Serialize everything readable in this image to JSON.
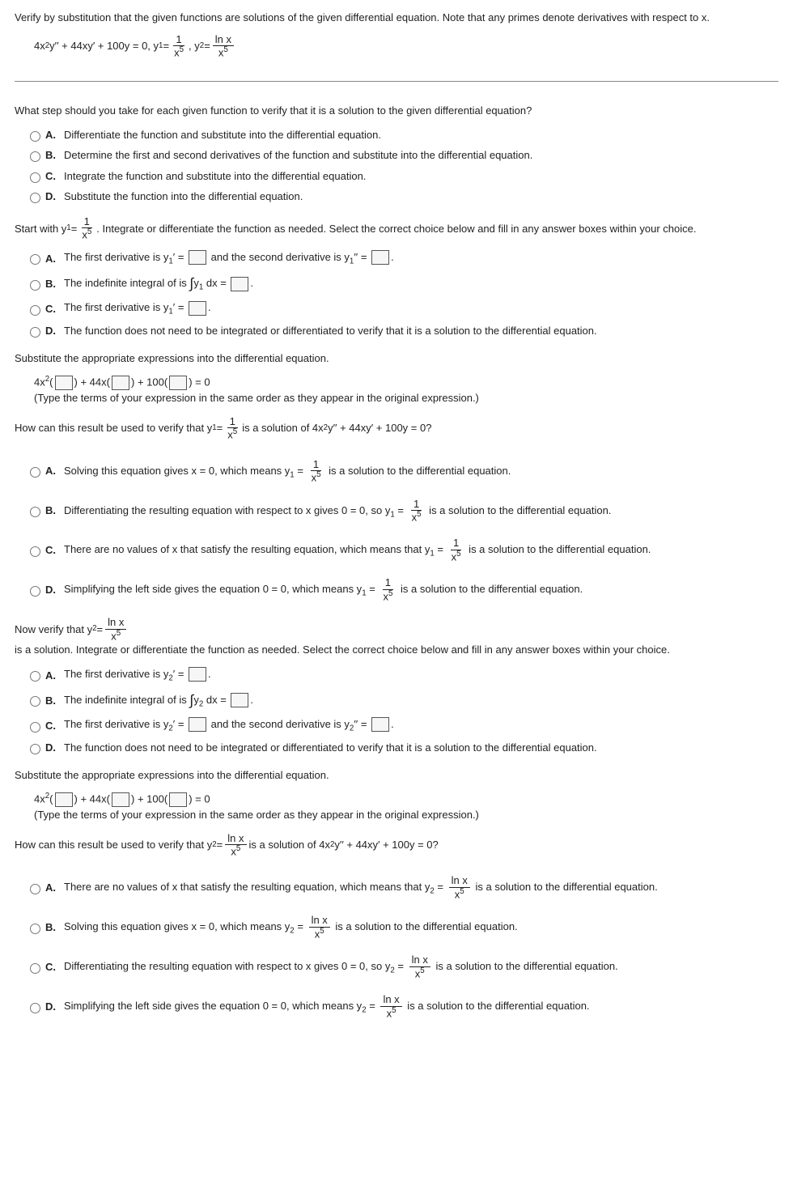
{
  "intro": "Verify by substitution that the given functions are solutions of the given differential equation. Note that any primes denote derivatives with respect to x.",
  "eq_lhs": "4x",
  "eq_y2d": "y′′ + 44xy′ + 100y = 0, y",
  "eq_eqal": " = ",
  "frac1_num": "1",
  "frac1_den_x": "x",
  "comma_y2": ", y",
  "frac2_num": "ln x",
  "frac2_den_x": "x",
  "q1": "What step should you take for each given function to verify that it is a solution to the given differential equation?",
  "q1a": "Differentiate the function and substitute into the differential equation.",
  "q1b": "Determine the first and second derivatives of the function and substitute into the differential equation.",
  "q1c": "Integrate the function and substitute into the differential equation.",
  "q1d": "Substitute the function into the differential equation.",
  "start_with": "Start with y",
  "start_rest": ". Integrate or differentiate the function as needed. Select the correct choice below and fill in any answer boxes within your choice.",
  "p1a_1": "The first derivative is y",
  "p1a_2": "′ = ",
  "p1a_3": " and the second derivative is y",
  "p1a_4": "′′ = ",
  "p1b_1": "The indefinite integral of is ",
  "p1b_2": " dx = ",
  "p1c_1": "The first derivative is y",
  "p1c_2": "′ = ",
  "p1d": "The function does not need to be integrated or differentiated to verify that it is a solution to the differential equation.",
  "sub_head": "Substitute the appropriate expressions into the differential equation.",
  "sub_eq_a": "4x",
  "sub_eq_plus44": " + 44x",
  "sub_eq_plus100": " + 100",
  "sub_eq_eq0": " = 0",
  "sub_note": "(Type the terms of your expression in the same order as they appear in the original expression.)",
  "q2_a": "How can this result be used to verify that y",
  "q2_is": " is a solution of 4x",
  "q2_tail": "y′′ + 44xy′ + 100y = 0?",
  "r1a_1": "Solving this equation gives x = 0, which means y",
  "r1_tail": " is a solution to the differential equation.",
  "r1b_1": "Differentiating the resulting equation with respect to x gives 0 = 0, so y",
  "r1c_1": "There are no values of x that satisfy the resulting equation, which means that y",
  "r1d_1": "Simplifying the left side gives the equation 0 = 0, which means y",
  "now_verify": "Now verify that y",
  "now_rest": " is a solution. Integrate or differentiate the function as needed. Select the correct choice below and fill in any answer boxes within your choice.",
  "p2a_1": "The first derivative is y",
  "p2b_1": "The indefinite integral of is ",
  "p2c_1": "The first derivative is y",
  "p2c_3": " and the second derivative is y",
  "q3_a": "How can this result be used to verify that y",
  "r2a_1": "There are no values of x that satisfy the resulting equation, which means that y",
  "r2b_1": "Solving this equation gives x = 0, which means y",
  "r2c_1": "Differentiating the resulting equation with respect to x gives 0 = 0, so y",
  "r2d_1": "Simplifying the left side gives the equation 0 = 0, which means y",
  "letters": {
    "A": "A.",
    "B": "B.",
    "C": "C.",
    "D": "D."
  },
  "sup2": "2",
  "sub1": "1",
  "sub2": "2",
  "sup5": "5"
}
